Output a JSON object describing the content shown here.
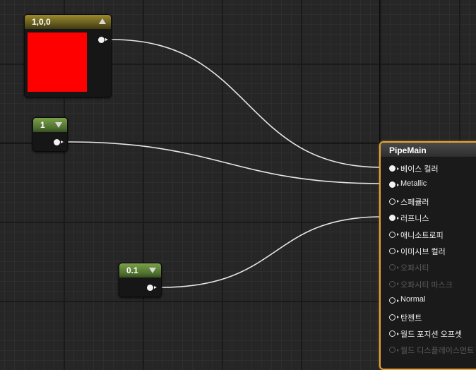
{
  "nodes": {
    "color_constant": {
      "title": "1,0,0",
      "color": "#ff0000"
    },
    "metallic_constant": {
      "title": "1"
    },
    "roughness_constant": {
      "title": "0.1"
    }
  },
  "material": {
    "title": "PipeMain",
    "accent": "#e8a33a",
    "inputs": [
      {
        "label": "베이스 컬러",
        "connected": true,
        "enabled": true
      },
      {
        "label": "Metallic",
        "connected": true,
        "enabled": true
      },
      {
        "label": "스페큘러",
        "connected": false,
        "enabled": true
      },
      {
        "label": "러프니스",
        "connected": true,
        "enabled": true
      },
      {
        "label": "애니소트로피",
        "connected": false,
        "enabled": true
      },
      {
        "label": "이미시브 컬러",
        "connected": false,
        "enabled": true
      },
      {
        "label": "오파시티",
        "connected": false,
        "enabled": false
      },
      {
        "label": "오파시티 마스크",
        "connected": false,
        "enabled": false
      },
      {
        "label": "Normal",
        "connected": false,
        "enabled": true
      },
      {
        "label": "탄젠트",
        "connected": false,
        "enabled": true
      },
      {
        "label": "월드 포지션 오프셋",
        "connected": false,
        "enabled": true
      },
      {
        "label": "월드 디스플레이스먼트",
        "connected": false,
        "enabled": false
      }
    ]
  }
}
